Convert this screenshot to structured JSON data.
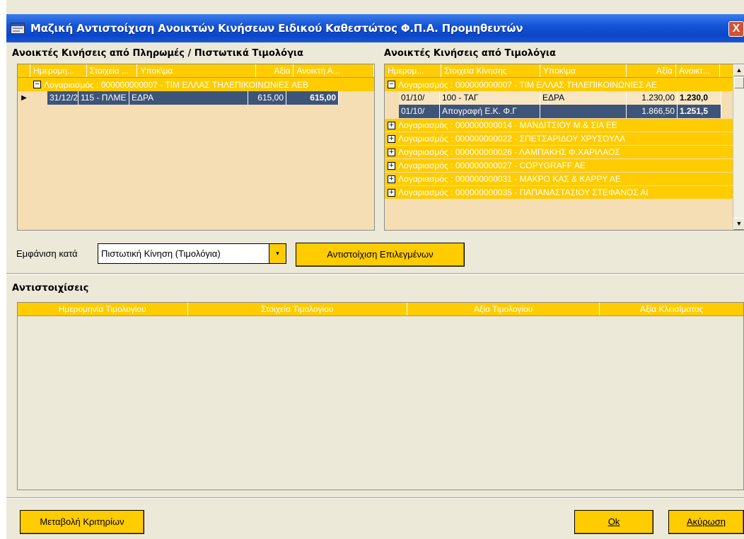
{
  "window": {
    "title": "Μαζική Αντιστοίχιση Ανοικτών Κινήσεων Ειδικού Καθεστώτος Φ.Π.Α. Προμηθευτών",
    "close_glyph": "X",
    "icon": "app-window-icon",
    "accent": "#ffcc00",
    "selection_color": "#3e5478"
  },
  "left_panel": {
    "title": "Ανοικτές Κινήσεις από Πληρωμές / Πιστωτικά Τιμολόγια",
    "columns": [
      "Ημερομη...",
      "Στοιχεία ...",
      "Υποκ\\μα",
      "Αξία",
      "Ανοικτή Α..."
    ],
    "groups": [
      {
        "sign": "−",
        "label": "Λογαριασμός : 000000000007 - ΤΙΜ ΕΛΛΑΣ ΤΗΛΕΠΙΚΟΙΝΩΝΙΕΣ ΑΕΒ",
        "rows": [
          {
            "date": "31/12/2",
            "details": "115 - ΠΛΜΕ",
            "sub": "ΕΔΡΑ",
            "value": "615,00",
            "open": "615,00"
          }
        ]
      }
    ],
    "row_indicator": "▶"
  },
  "right_panel": {
    "title": "Ανοικτές Κινήσεις από Τιμολόγια",
    "columns": [
      "Ημερομ...",
      "Στοιχεία Κίνησης",
      "Υποκ\\μα",
      "Αξία",
      "Ανοικτ..."
    ],
    "expanded_group": {
      "sign": "−",
      "label": "Λογαριασμός : 000000000007 - ΤΙΜ ΕΛΛΑΣ ΤΗΛΕΠΙΚΟΙΝΩΝΙΕΣ ΑΕ",
      "rows": [
        {
          "date": "01/10/",
          "details": "100 - ΤΑΓ",
          "sub": "ΕΔΡΑ",
          "value": "1.230,00",
          "open": "1.230,0"
        },
        {
          "date": "01/10/",
          "details": "Απογραφή Ε.Κ. Φ.Γ",
          "sub": "",
          "value": "1.866,50",
          "open": "1.251,5"
        }
      ]
    },
    "collapsed_groups": [
      "Λογαριασμός : 000000000014 - ΜΑΝΔΙΤΣΙΟΥ Μ.& ΣΙΑ ΕΕ",
      "Λογαριασμός : 000000000022 - ΣΠΕΤΣΑΡΙΔΟΥ ΧΡΥΣΟΥΛΑ",
      "Λογαριασμός : 000000000026 - ΛΑΜΠΑΚΗΣ Φ.ΧΑΡΙΛΑΟΣ",
      "Λογαριασμός : 000000000027 - COPYGRAFF AE",
      "Λογαριασμός : 000000000031 - ΜΑΚΡΟ ΚΑΣ & ΚΑΡΡΥ ΑΕ",
      "Λογαριασμός : 000000000035 - ΠΑΠΑΝΑΣΤΑΣΙΟΥ ΣΤΕΦΑΝΟΣ ΑΙ"
    ],
    "plus_sign": "+",
    "scroll_up": "▲",
    "scroll_down": "▼"
  },
  "toolbar": {
    "display_by_label": "Εμφάνιση κατά",
    "display_by_value": "Πιστωτική Κίνηση (Τιμολόγια)",
    "dropdown_glyph": "▾",
    "match_selected_button": "Αντιστοίχιση Επιλεγμένων"
  },
  "matches": {
    "title": "Αντιστοιχίσεις",
    "columns": [
      "Ημερομηνία Τιμολογίου",
      "Στοιχεία Τιμολογίου",
      "Αξία Τιμολογίου",
      "Αξία Κλεισίματος"
    ]
  },
  "footer": {
    "change_criteria_button": "Μεταβολή Κριτηρίων",
    "ok_button": "Ok",
    "cancel_button": "Ακύρωση"
  }
}
